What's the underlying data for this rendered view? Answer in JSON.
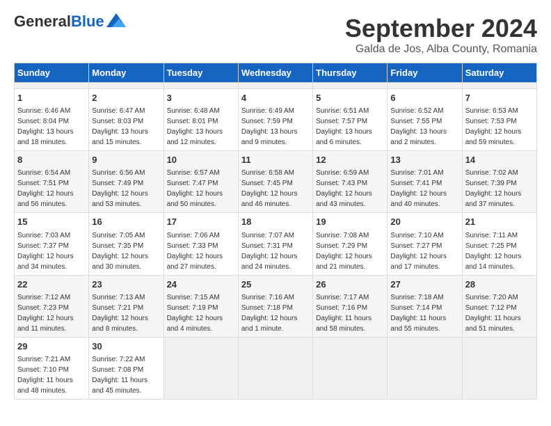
{
  "header": {
    "logo_general": "General",
    "logo_blue": "Blue",
    "month_title": "September 2024",
    "location": "Galda de Jos, Alba County, Romania"
  },
  "calendar": {
    "days_of_week": [
      "Sunday",
      "Monday",
      "Tuesday",
      "Wednesday",
      "Thursday",
      "Friday",
      "Saturday"
    ],
    "weeks": [
      [
        {
          "day": "",
          "empty": true
        },
        {
          "day": "",
          "empty": true
        },
        {
          "day": "",
          "empty": true
        },
        {
          "day": "",
          "empty": true
        },
        {
          "day": "",
          "empty": true
        },
        {
          "day": "",
          "empty": true
        },
        {
          "day": "",
          "empty": true
        }
      ],
      [
        {
          "day": "1",
          "sunrise": "Sunrise: 6:46 AM",
          "sunset": "Sunset: 8:04 PM",
          "daylight": "Daylight: 13 hours and 18 minutes."
        },
        {
          "day": "2",
          "sunrise": "Sunrise: 6:47 AM",
          "sunset": "Sunset: 8:03 PM",
          "daylight": "Daylight: 13 hours and 15 minutes."
        },
        {
          "day": "3",
          "sunrise": "Sunrise: 6:48 AM",
          "sunset": "Sunset: 8:01 PM",
          "daylight": "Daylight: 13 hours and 12 minutes."
        },
        {
          "day": "4",
          "sunrise": "Sunrise: 6:49 AM",
          "sunset": "Sunset: 7:59 PM",
          "daylight": "Daylight: 13 hours and 9 minutes."
        },
        {
          "day": "5",
          "sunrise": "Sunrise: 6:51 AM",
          "sunset": "Sunset: 7:57 PM",
          "daylight": "Daylight: 13 hours and 6 minutes."
        },
        {
          "day": "6",
          "sunrise": "Sunrise: 6:52 AM",
          "sunset": "Sunset: 7:55 PM",
          "daylight": "Daylight: 13 hours and 2 minutes."
        },
        {
          "day": "7",
          "sunrise": "Sunrise: 6:53 AM",
          "sunset": "Sunset: 7:53 PM",
          "daylight": "Daylight: 12 hours and 59 minutes."
        }
      ],
      [
        {
          "day": "8",
          "sunrise": "Sunrise: 6:54 AM",
          "sunset": "Sunset: 7:51 PM",
          "daylight": "Daylight: 12 hours and 56 minutes."
        },
        {
          "day": "9",
          "sunrise": "Sunrise: 6:56 AM",
          "sunset": "Sunset: 7:49 PM",
          "daylight": "Daylight: 12 hours and 53 minutes."
        },
        {
          "day": "10",
          "sunrise": "Sunrise: 6:57 AM",
          "sunset": "Sunset: 7:47 PM",
          "daylight": "Daylight: 12 hours and 50 minutes."
        },
        {
          "day": "11",
          "sunrise": "Sunrise: 6:58 AM",
          "sunset": "Sunset: 7:45 PM",
          "daylight": "Daylight: 12 hours and 46 minutes."
        },
        {
          "day": "12",
          "sunrise": "Sunrise: 6:59 AM",
          "sunset": "Sunset: 7:43 PM",
          "daylight": "Daylight: 12 hours and 43 minutes."
        },
        {
          "day": "13",
          "sunrise": "Sunrise: 7:01 AM",
          "sunset": "Sunset: 7:41 PM",
          "daylight": "Daylight: 12 hours and 40 minutes."
        },
        {
          "day": "14",
          "sunrise": "Sunrise: 7:02 AM",
          "sunset": "Sunset: 7:39 PM",
          "daylight": "Daylight: 12 hours and 37 minutes."
        }
      ],
      [
        {
          "day": "15",
          "sunrise": "Sunrise: 7:03 AM",
          "sunset": "Sunset: 7:37 PM",
          "daylight": "Daylight: 12 hours and 34 minutes."
        },
        {
          "day": "16",
          "sunrise": "Sunrise: 7:05 AM",
          "sunset": "Sunset: 7:35 PM",
          "daylight": "Daylight: 12 hours and 30 minutes."
        },
        {
          "day": "17",
          "sunrise": "Sunrise: 7:06 AM",
          "sunset": "Sunset: 7:33 PM",
          "daylight": "Daylight: 12 hours and 27 minutes."
        },
        {
          "day": "18",
          "sunrise": "Sunrise: 7:07 AM",
          "sunset": "Sunset: 7:31 PM",
          "daylight": "Daylight: 12 hours and 24 minutes."
        },
        {
          "day": "19",
          "sunrise": "Sunrise: 7:08 AM",
          "sunset": "Sunset: 7:29 PM",
          "daylight": "Daylight: 12 hours and 21 minutes."
        },
        {
          "day": "20",
          "sunrise": "Sunrise: 7:10 AM",
          "sunset": "Sunset: 7:27 PM",
          "daylight": "Daylight: 12 hours and 17 minutes."
        },
        {
          "day": "21",
          "sunrise": "Sunrise: 7:11 AM",
          "sunset": "Sunset: 7:25 PM",
          "daylight": "Daylight: 12 hours and 14 minutes."
        }
      ],
      [
        {
          "day": "22",
          "sunrise": "Sunrise: 7:12 AM",
          "sunset": "Sunset: 7:23 PM",
          "daylight": "Daylight: 12 hours and 11 minutes."
        },
        {
          "day": "23",
          "sunrise": "Sunrise: 7:13 AM",
          "sunset": "Sunset: 7:21 PM",
          "daylight": "Daylight: 12 hours and 8 minutes."
        },
        {
          "day": "24",
          "sunrise": "Sunrise: 7:15 AM",
          "sunset": "Sunset: 7:19 PM",
          "daylight": "Daylight: 12 hours and 4 minutes."
        },
        {
          "day": "25",
          "sunrise": "Sunrise: 7:16 AM",
          "sunset": "Sunset: 7:18 PM",
          "daylight": "Daylight: 12 hours and 1 minute."
        },
        {
          "day": "26",
          "sunrise": "Sunrise: 7:17 AM",
          "sunset": "Sunset: 7:16 PM",
          "daylight": "Daylight: 11 hours and 58 minutes."
        },
        {
          "day": "27",
          "sunrise": "Sunrise: 7:18 AM",
          "sunset": "Sunset: 7:14 PM",
          "daylight": "Daylight: 11 hours and 55 minutes."
        },
        {
          "day": "28",
          "sunrise": "Sunrise: 7:20 AM",
          "sunset": "Sunset: 7:12 PM",
          "daylight": "Daylight: 11 hours and 51 minutes."
        }
      ],
      [
        {
          "day": "29",
          "sunrise": "Sunrise: 7:21 AM",
          "sunset": "Sunset: 7:10 PM",
          "daylight": "Daylight: 11 hours and 48 minutes."
        },
        {
          "day": "30",
          "sunrise": "Sunrise: 7:22 AM",
          "sunset": "Sunset: 7:08 PM",
          "daylight": "Daylight: 11 hours and 45 minutes."
        },
        {
          "day": "",
          "empty": true
        },
        {
          "day": "",
          "empty": true
        },
        {
          "day": "",
          "empty": true
        },
        {
          "day": "",
          "empty": true
        },
        {
          "day": "",
          "empty": true
        }
      ]
    ]
  }
}
